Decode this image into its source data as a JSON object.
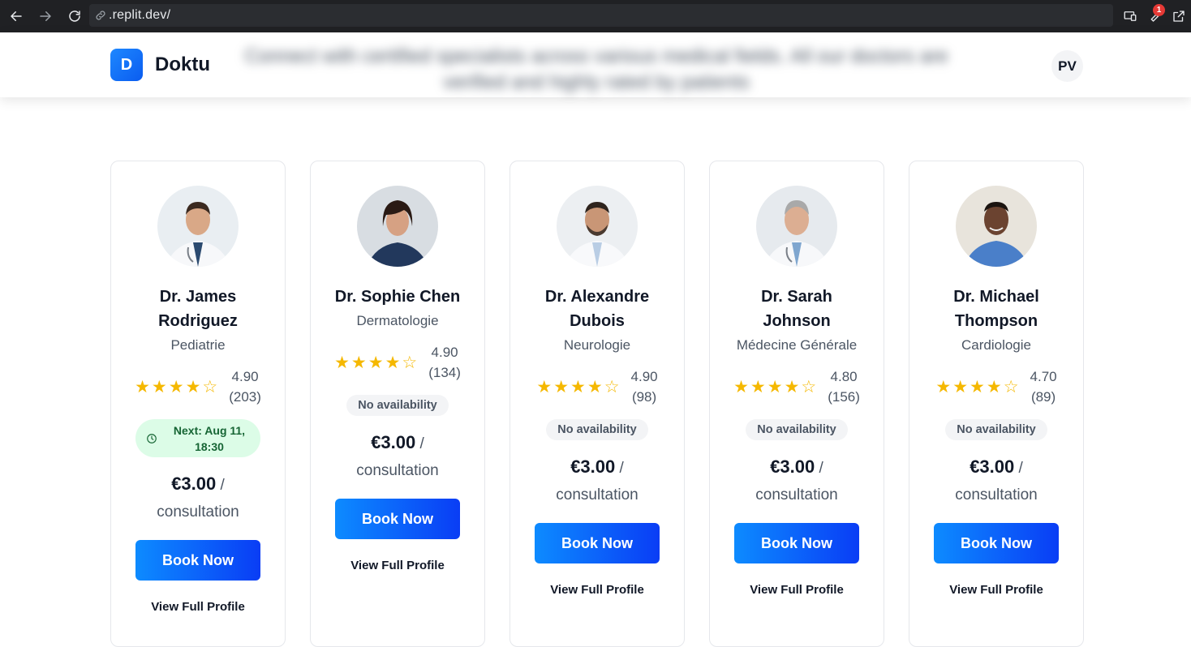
{
  "browser": {
    "url": ".replit.dev/",
    "notification_count": "1"
  },
  "header": {
    "logo_letter": "D",
    "brand": "Doktu",
    "tagline": "Connect with certified specialists across various medical fields. All our doctors are verified and highly rated by patients",
    "user_initials": "PV"
  },
  "labels": {
    "book_now": "Book Now",
    "view_profile": "View Full Profile",
    "per_consultation": "consultation",
    "no_availability": "No availability"
  },
  "colors": {
    "accent_start": "#0d8bff",
    "accent_end": "#0a3df5",
    "star": "#f5b800",
    "available_bg": "#dcfce7",
    "available_text": "#166534"
  },
  "doctors": [
    {
      "name": "Dr. James Rodriguez",
      "specialty": "Pediatrie",
      "stars": 4,
      "rating": "4.90",
      "reviews": "(203)",
      "availability": "Next: Aug 11, 18:30",
      "available": true,
      "price": "€3.00",
      "price_sep": " /"
    },
    {
      "name": "Dr. Sophie Chen",
      "specialty": "Dermatologie",
      "stars": 4,
      "rating": "4.90",
      "reviews": "(134)",
      "availability": "No availability",
      "available": false,
      "price": "€3.00",
      "price_sep": " /"
    },
    {
      "name": "Dr. Alexandre Dubois",
      "specialty": "Neurologie",
      "stars": 4,
      "rating": "4.90",
      "reviews": "(98)",
      "availability": "No availability",
      "available": false,
      "price": "€3.00",
      "price_sep": " /"
    },
    {
      "name": "Dr. Sarah Johnson",
      "specialty": "Médecine Générale",
      "stars": 4,
      "rating": "4.80",
      "reviews": "(156)",
      "availability": "No availability",
      "available": false,
      "price": "€3.00",
      "price_sep": " /"
    },
    {
      "name": "Dr. Michael Thompson",
      "specialty": "Cardiologie",
      "stars": 4,
      "rating": "4.70",
      "reviews": "(89)",
      "availability": "No availability",
      "available": false,
      "price": "€3.00",
      "price_sep": " /"
    }
  ]
}
